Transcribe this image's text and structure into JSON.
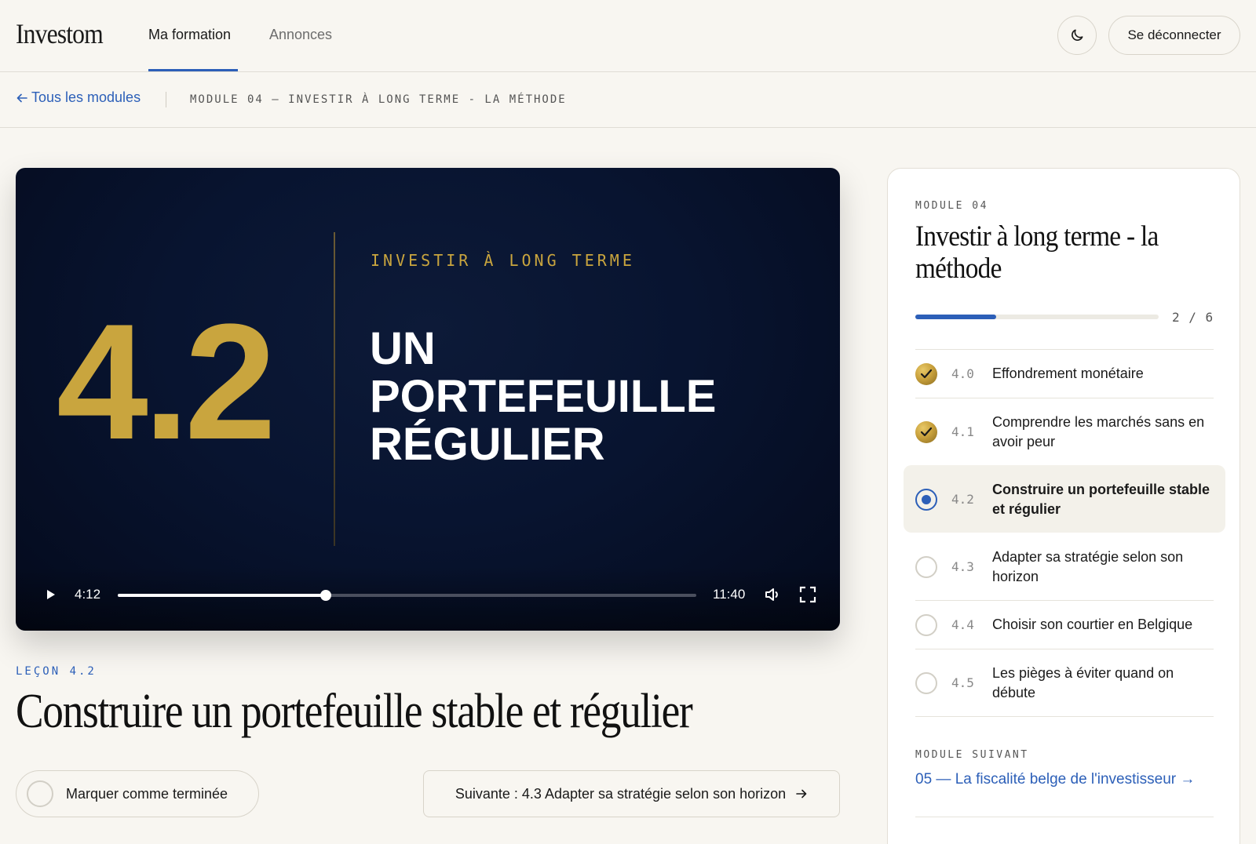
{
  "header": {
    "logo": "Investom",
    "nav": [
      {
        "label": "Ma formation",
        "active": true
      },
      {
        "label": "Annonces",
        "active": false
      }
    ],
    "theme_icon": "moon-icon",
    "logout_label": "Se déconnecter"
  },
  "breadcrumb": {
    "back_label": "Tous les modules",
    "back_icon": "arrow-left-icon",
    "module_label": "MODULE 04 — INVESTIR À LONG TERME - LA MÉTHODE"
  },
  "video": {
    "number": "4.2",
    "kicker": "INVESTIR À LONG TERME",
    "title_lines": [
      "UN",
      "PORTEFEUILLE",
      "RÉGULIER"
    ],
    "current_time": "4:12",
    "total_time": "11:40",
    "progress": 0.36,
    "icons": {
      "play": "play-icon",
      "volume": "volume-icon",
      "fullscreen": "fullscreen-icon"
    },
    "colors": {
      "gold": "#c9a53e",
      "background": "#081430"
    }
  },
  "lesson": {
    "kicker": "LEÇON 4.2",
    "title": "Construire un portefeuille stable et régulier",
    "mark_done_label": "Marquer comme terminée",
    "next_label": "Suivante : 4.3 Adapter sa stratégie selon son horizon",
    "next_icon": "arrow-right-icon"
  },
  "sidebar": {
    "kicker": "MODULE 04",
    "title": "Investir à long terme - la méthode",
    "progress_text": "2 / 6",
    "progress": 0.333,
    "lessons": [
      {
        "num": "4.0",
        "label": "Effondrement monétaire",
        "status": "done"
      },
      {
        "num": "4.1",
        "label": "Comprendre les marchés sans en avoir peur",
        "status": "done"
      },
      {
        "num": "4.2",
        "label": "Construire un portefeuille stable et régulier",
        "status": "current"
      },
      {
        "num": "4.3",
        "label": "Adapter sa stratégie selon son horizon",
        "status": "todo"
      },
      {
        "num": "4.4",
        "label": "Choisir son courtier en Belgique",
        "status": "todo"
      },
      {
        "num": "4.5",
        "label": "Les pièges à éviter quand on débute",
        "status": "todo"
      }
    ],
    "next_module_kicker": "MODULE SUIVANT",
    "next_module_label": "05 — La fiscalité belge de l'investisseur →"
  },
  "colors": {
    "accent": "#2c5fb8",
    "gold": "#c9a53e",
    "background": "#f8f6f1"
  }
}
